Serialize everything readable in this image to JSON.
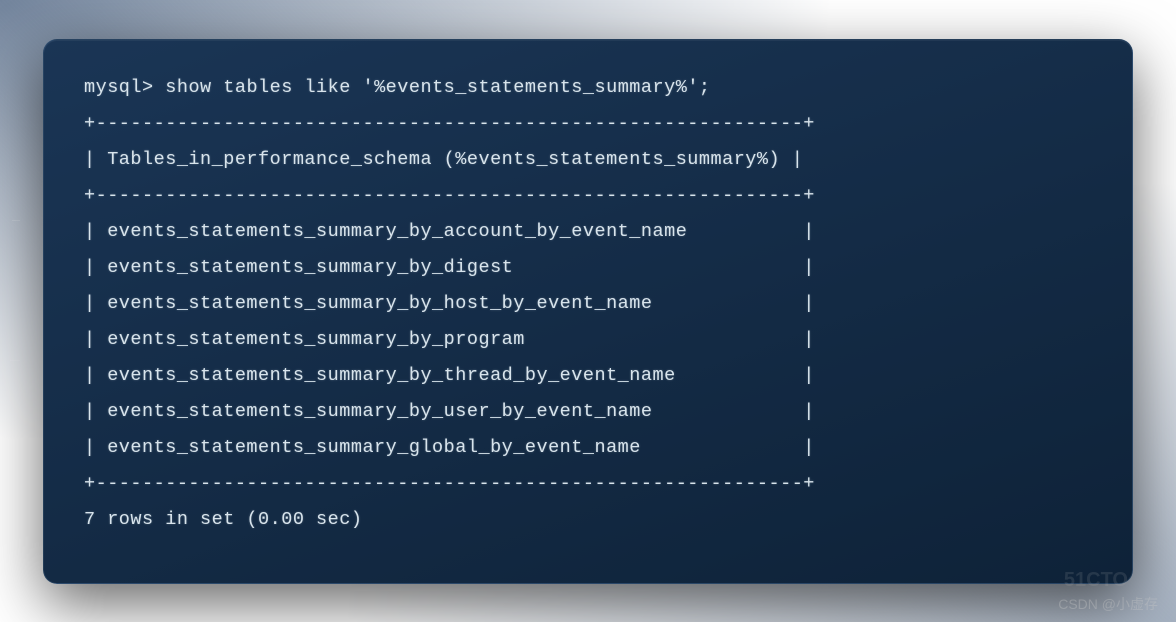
{
  "terminal": {
    "prompt": "mysql>",
    "command": "show tables like '%events_statements_summary%';",
    "separator_top": "+-------------------------------------------------------------+",
    "header_row": "| Tables_in_performance_schema (%events_statements_summary%) |",
    "separator_mid": "+-------------------------------------------------------------+",
    "rows": [
      "| events_statements_summary_by_account_by_event_name          |",
      "| events_statements_summary_by_digest                         |",
      "| events_statements_summary_by_host_by_event_name             |",
      "| events_statements_summary_by_program                        |",
      "| events_statements_summary_by_thread_by_event_name           |",
      "| events_statements_summary_by_user_by_event_name             |",
      "| events_statements_summary_global_by_event_name              |"
    ],
    "separator_bot": "+-------------------------------------------------------------+",
    "footer": "7 rows in set (0.00 sec)"
  },
  "watermark": {
    "bg": "51CTO",
    "text": "CSDN @小虚存"
  }
}
